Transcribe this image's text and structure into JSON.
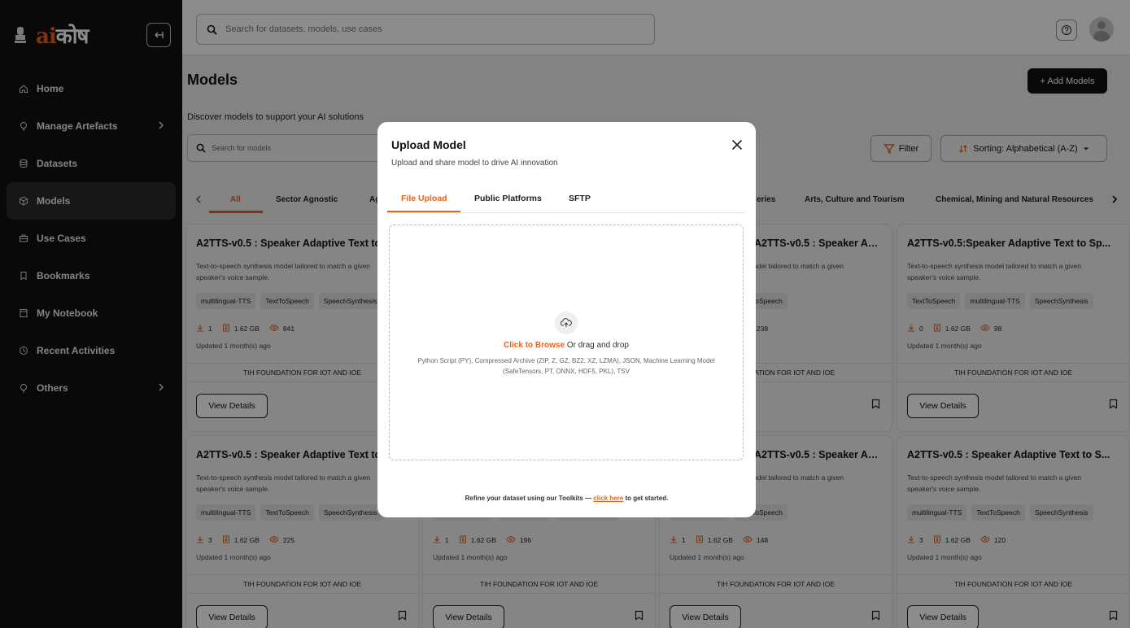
{
  "sidebar": {
    "logo": {
      "ai": "ai",
      "rest": "कोष"
    },
    "items": [
      {
        "label": "Home",
        "icon": "home-icon"
      },
      {
        "label": "Manage Artefacts",
        "icon": "lightbulb-icon",
        "chevron": true
      },
      {
        "label": "Datasets",
        "icon": "database-icon"
      },
      {
        "label": "Models",
        "icon": "cube-icon",
        "active": true
      },
      {
        "label": "Use Cases",
        "icon": "briefcase-icon"
      },
      {
        "label": "Bookmarks",
        "icon": "bookmark-icon"
      },
      {
        "label": "My Notebook",
        "icon": "notebook-icon"
      },
      {
        "label": "Recent Activities",
        "icon": "clock-icon"
      },
      {
        "label": "Others",
        "icon": "lightbulb-icon",
        "chevron": true
      }
    ]
  },
  "topbar": {
    "search_placeholder": "Search for datasets, models, use cases"
  },
  "page": {
    "title": "Models",
    "add_label": "+ Add Models",
    "subtitle": "Discover models to support your AI solutions",
    "search_placeholder": "Search for models",
    "filter_label": "Filter",
    "sort_label": "Sorting: Alphabetical (A-Z)"
  },
  "categories": {
    "all": "All",
    "sector": "Sector Agnostic",
    "ag": "Ag",
    "eries": "eries",
    "arts": "Arts, Culture and Tourism",
    "chemical": "Chemical, Mining and Natural Resources"
  },
  "cards": [
    {
      "title": "A2TTS-v0.5 : Speaker Adaptive Text to Speech",
      "desc": "Text-to-speech synthesis model tailored to match a given speaker's voice sample.",
      "tags": [
        "multilingual-TTS",
        "TextToSpeech",
        "SpeechSynthesis"
      ],
      "downloads": "1",
      "size": "1.62 GB",
      "views": "841",
      "updated": "Updated 1 month(s) ago",
      "org": "TIH FOUNDATION FOR IOT AND IOE",
      "view": "View Details"
    },
    {
      "title": "A2TTS-v0.5 : Speaker Adaptive Text to S...",
      "desc": "Text-to-speech synthesis model tailored to match a given speaker's voice sample.",
      "tags": [
        "multilingual-TTS",
        "TextToSpeech"
      ],
      "downloads": "1",
      "size": "1.62 GB",
      "views": "238",
      "updated": "Updated 1 month(s) ago",
      "org": "TIH FOUNDATION FOR IOT AND IOE",
      "view": "View Details"
    },
    {
      "title": "A2TTS-v0.5:Speaker Adaptive Text to Sp...",
      "desc": "Text-to-speech synthesis model tailored to match a given speaker's voice sample.",
      "tags": [
        "TextToSpeech",
        "multilingual-TTS",
        "SpeechSynthesis"
      ],
      "downloads": "0",
      "size": "1.62 GB",
      "views": "98",
      "updated": "Updated 1 month(s) ago",
      "org": "TIH FOUNDATION FOR IOT AND IOE",
      "view": "View Details"
    },
    {
      "title": "A2TTS-v0.5 : Speaker Adaptive Text to Speech",
      "desc": "Text-to-speech synthesis model tailored to match a given speaker's voice sample.",
      "tags": [
        "multilingual-TTS",
        "TextToSpeech",
        "SpeechSynthesis"
      ],
      "downloads": "3",
      "size": "1.62 GB",
      "views": "225",
      "updated": "Updated 1 month(s) ago",
      "org": "TIH FOUNDATION FOR IOT AND IOE",
      "view": "View Details"
    },
    {
      "title": "A2TTS-v0.5 : Speaker Adaptive Text to Speech",
      "desc": "Text-to-speech synthesis model tailored to match a given speaker's voice sample.",
      "tags": [
        "multilingual-TTS",
        "TextToSpeech",
        "SpeechSynthesis"
      ],
      "downloads": "1",
      "size": "1.62 GB",
      "views": "196",
      "updated": "Updated 1 month(s) ago",
      "org": "TIH FOUNDATION FOR IOT AND IOE",
      "view": "View Details"
    },
    {
      "title": "A2TTS-v0.5 : Speaker Adaptive Text to S...",
      "desc": "Text-to-speech synthesis model tailored to match a given speaker's voice sample.",
      "tags": [
        "multilingual-TTS",
        "TextToSpeech"
      ],
      "downloads": "1",
      "size": "1.62 GB",
      "views": "148",
      "updated": "Updated 1 month(s) ago",
      "org": "TIH FOUNDATION FOR IOT AND IOE",
      "view": "View Details"
    },
    {
      "title": "A2TTS-v0.5 : Speaker Adaptive Text to S...",
      "desc": "Text-to-speech synthesis model tailored to match a given speaker's voice sample.",
      "tags": [
        "multilingual-TTS",
        "TextToSpeech",
        "SpeechSynthesis"
      ],
      "downloads": "3",
      "size": "1.62 GB",
      "views": "120",
      "updated": "Updated 1 month(s) ago",
      "org": "TIH FOUNDATION FOR IOT AND IOE",
      "view": "View Details"
    }
  ],
  "modal": {
    "title": "Upload Model",
    "subtitle": "Upload and share model to drive AI innovation",
    "tabs": [
      "File Upload",
      "Public Platforms",
      "SFTP"
    ],
    "browse": "Click to Browse",
    "drag": " Or drag and drop",
    "formats": "Python Script (PY), Compressed Archive (ZIP, Z, GZ, BZ2, XZ, LZMA), JSON, Machine Learning Model (SafeTensors, PT, ONNX, HDF5, PKL), TSV",
    "refine_pre": "Refine your dataset using our Toolkits — ",
    "refine_link": "click here",
    "refine_post": " to get started."
  },
  "colors": {
    "accent": "#e8621f",
    "sidebar_bg": "#111111"
  }
}
